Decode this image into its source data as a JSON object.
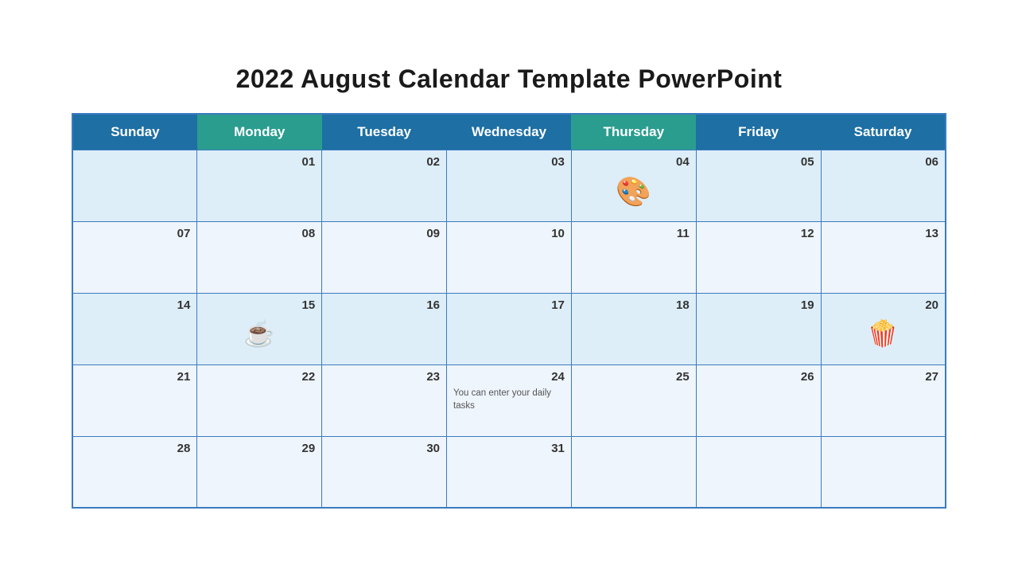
{
  "title": "2022 August Calendar Template PowerPoint",
  "headers": {
    "sunday": "Sunday",
    "monday": "Monday",
    "tuesday": "Tuesday",
    "wednesday": "Wednesday",
    "thursday": "Thursday",
    "friday": "Friday",
    "saturday": "Saturday"
  },
  "rows": [
    {
      "id": "row1",
      "cells": [
        {
          "day": "",
          "icon": null,
          "note": ""
        },
        {
          "day": "01",
          "icon": null,
          "note": ""
        },
        {
          "day": "02",
          "icon": null,
          "note": ""
        },
        {
          "day": "03",
          "icon": null,
          "note": ""
        },
        {
          "day": "04",
          "icon": "palette",
          "note": ""
        },
        {
          "day": "05",
          "icon": null,
          "note": ""
        },
        {
          "day": "06",
          "icon": null,
          "note": ""
        }
      ]
    },
    {
      "id": "row2",
      "cells": [
        {
          "day": "07",
          "icon": null,
          "note": ""
        },
        {
          "day": "08",
          "icon": null,
          "note": ""
        },
        {
          "day": "09",
          "icon": null,
          "note": ""
        },
        {
          "day": "10",
          "icon": null,
          "note": ""
        },
        {
          "day": "11",
          "icon": null,
          "note": ""
        },
        {
          "day": "12",
          "icon": null,
          "note": ""
        },
        {
          "day": "13",
          "icon": null,
          "note": ""
        }
      ]
    },
    {
      "id": "row3",
      "cells": [
        {
          "day": "14",
          "icon": null,
          "note": ""
        },
        {
          "day": "15",
          "icon": "coffee",
          "note": ""
        },
        {
          "day": "16",
          "icon": null,
          "note": ""
        },
        {
          "day": "17",
          "icon": null,
          "note": ""
        },
        {
          "day": "18",
          "icon": null,
          "note": ""
        },
        {
          "day": "19",
          "icon": null,
          "note": ""
        },
        {
          "day": "20",
          "icon": "popcorn",
          "note": ""
        }
      ]
    },
    {
      "id": "row4",
      "cells": [
        {
          "day": "21",
          "icon": null,
          "note": ""
        },
        {
          "day": "22",
          "icon": null,
          "note": ""
        },
        {
          "day": "23",
          "icon": null,
          "note": ""
        },
        {
          "day": "24",
          "icon": null,
          "note": "You can enter your daily tasks"
        },
        {
          "day": "25",
          "icon": null,
          "note": ""
        },
        {
          "day": "26",
          "icon": null,
          "note": ""
        },
        {
          "day": "27",
          "icon": null,
          "note": ""
        }
      ]
    },
    {
      "id": "row5",
      "cells": [
        {
          "day": "28",
          "icon": null,
          "note": ""
        },
        {
          "day": "29",
          "icon": null,
          "note": ""
        },
        {
          "day": "30",
          "icon": null,
          "note": ""
        },
        {
          "day": "31",
          "icon": null,
          "note": ""
        },
        {
          "day": "",
          "icon": null,
          "note": ""
        },
        {
          "day": "",
          "icon": null,
          "note": ""
        },
        {
          "day": "",
          "icon": null,
          "note": ""
        }
      ]
    }
  ],
  "icons": {
    "palette": "🎨",
    "coffee": "☕",
    "popcorn": "🍿"
  }
}
